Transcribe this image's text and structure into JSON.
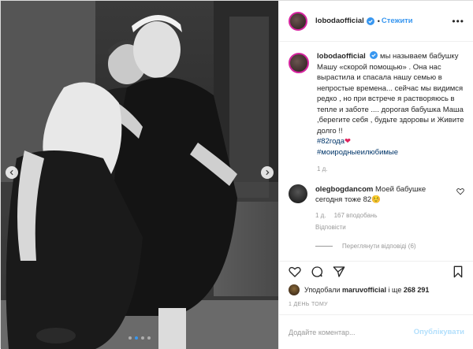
{
  "post": {
    "username": "lobodaofficial",
    "follow_label": "Стежити",
    "more_icon": "more-options-icon",
    "photo": {
      "description_icon": "photo-image",
      "dot_count": 4,
      "active_dot": 2
    },
    "caption": {
      "username": "lobodaofficial",
      "text": "мы называем бабушку Машу «скорой помощью» . Она нас вырастила и спасала нашу семью в непростые времена... сейчас мы видимся редко , но при встрече я растворяюсь в тепле и заботе .... дорогая бабушка Маша ,берегите себя , будьте здоровы и Живите долго !!",
      "hashtag1": "#82года",
      "hashtag2": "#моиродныеилюбимые",
      "time": "1 д."
    },
    "comments": [
      {
        "username": "olegbogdancom",
        "text": "Моей бабушке сегодня тоже 82☺️",
        "time": "1 д.",
        "likes": "167 вподобань",
        "reply_label": "Відповісти",
        "view_replies": "Переглянути відповіді (6)"
      }
    ],
    "likes": {
      "prefix": "Уподобали",
      "user": "maruvofficial",
      "middle": "і ще",
      "count": "268 291"
    },
    "time_ago": "1 ДЕНЬ ТОМУ",
    "add_comment": {
      "placeholder": "Додайте коментар...",
      "publish_label": "Опублікувати"
    },
    "colors": {
      "link_blue": "#3897f0",
      "hashtag": "#003569",
      "muted": "#999999",
      "heart": "#e0245e"
    }
  }
}
